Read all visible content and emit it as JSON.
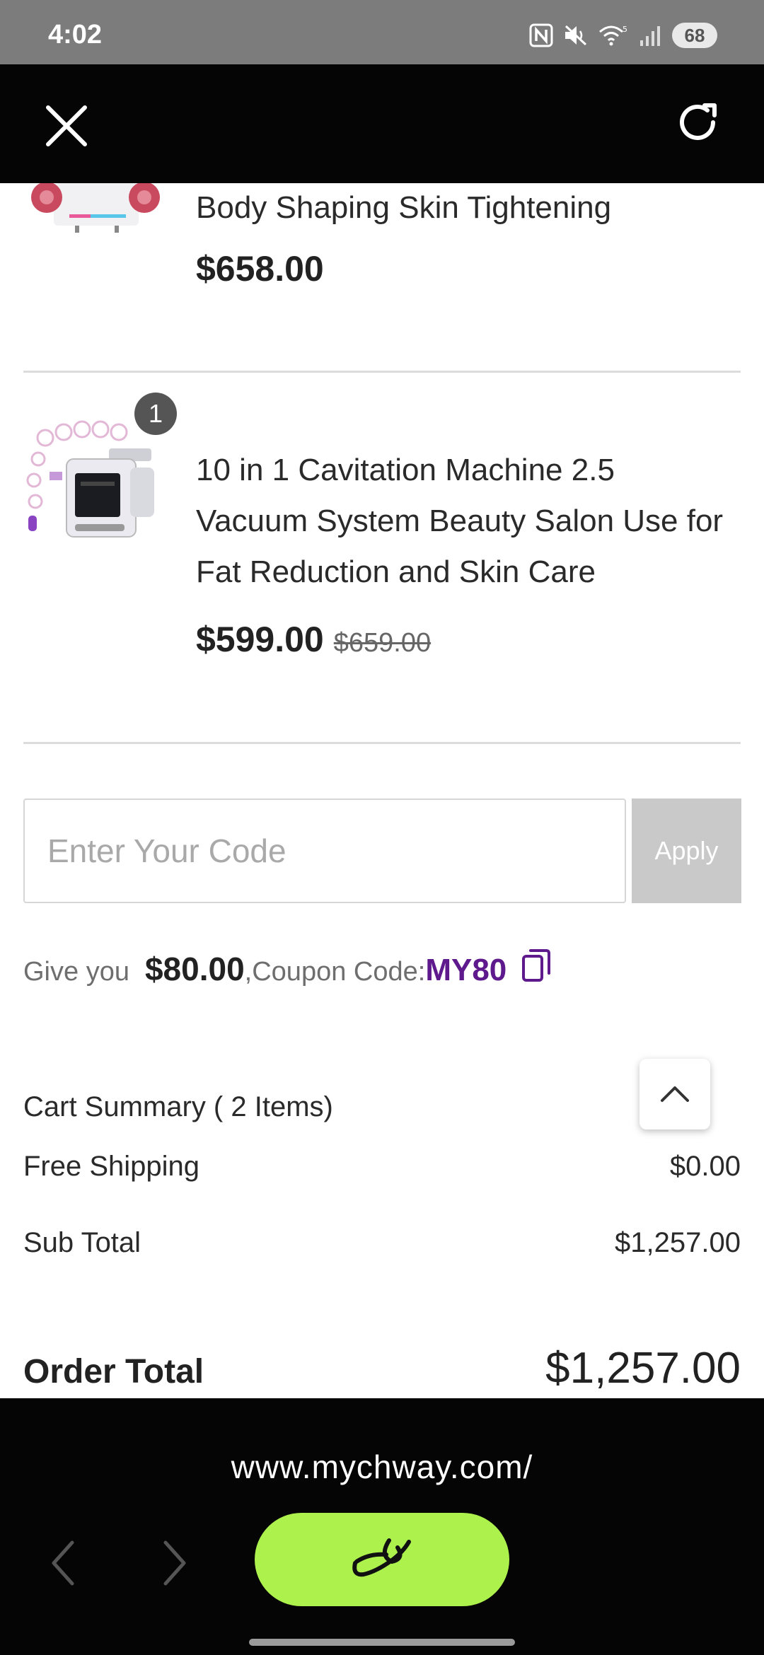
{
  "status_bar": {
    "time": "4:02",
    "battery": "68",
    "icons": [
      "nfc-icon",
      "mute-icon",
      "wifi-icon",
      "signal-icon",
      "battery-icon"
    ]
  },
  "top_bar": {
    "close_icon": "close-icon",
    "reload_icon": "reload-icon"
  },
  "cart": {
    "items": [
      {
        "title": "Body Shaping Skin Tightening",
        "price": "$658.00"
      },
      {
        "quantity": "1",
        "title": "10 in 1 Cavitation Machine 2.5 Vacuum System Beauty Salon Use for Fat Reduction and Skin Care",
        "price": "$599.00",
        "old_price": "$659.00"
      }
    ],
    "coupon": {
      "placeholder": "Enter Your Code",
      "apply_label": "Apply",
      "give_prefix": "Give you",
      "amount": "$80.00",
      "code_label": ",Coupon Code:",
      "code": "MY80"
    },
    "summary": {
      "heading": "Cart Summary ( 2 Items)",
      "shipping_label": "Free Shipping",
      "shipping_value": "$0.00",
      "subtotal_label": "Sub Total",
      "subtotal_value": "$1,257.00",
      "order_total_label": "Order Total",
      "order_total_value": "$1,257.00"
    }
  },
  "browser": {
    "url": "www.mychway.com/",
    "accent_color": "#adf24c"
  }
}
